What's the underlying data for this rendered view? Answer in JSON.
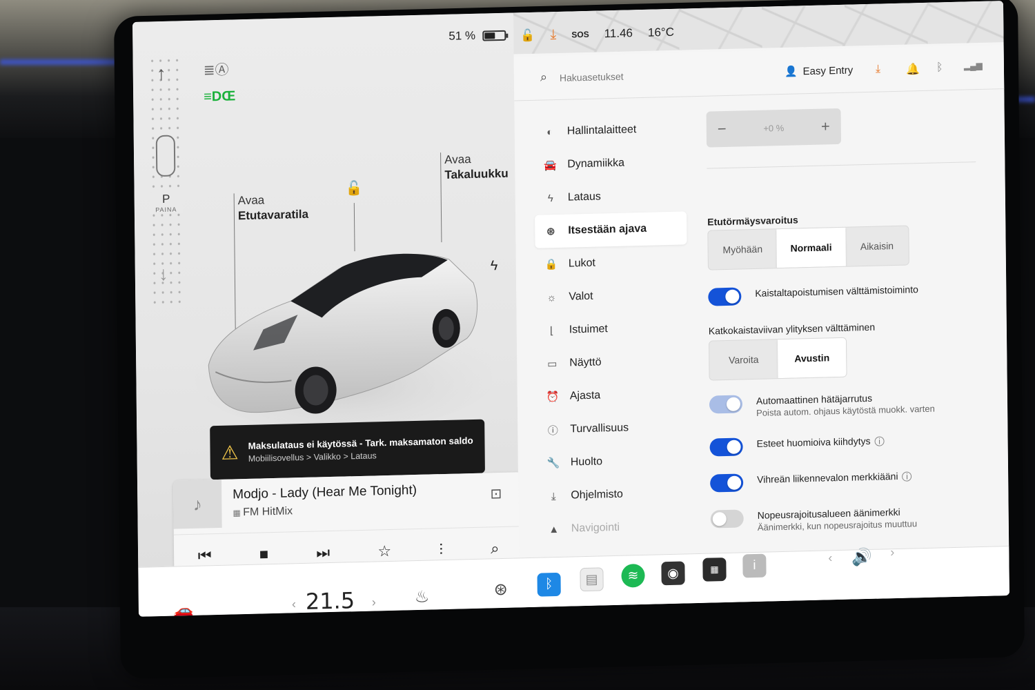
{
  "status": {
    "battery_pct": "51 %",
    "battery_level": 0.51,
    "sos": "SOS",
    "time": "11.46",
    "outside_temp": "16°C"
  },
  "left": {
    "gear": "P",
    "gear_hint": "PAINA",
    "label_frunk_1": "Avaa",
    "label_frunk_2": "Etutavaratila",
    "label_trunk_1": "Avaa",
    "label_trunk_2": "Takaluukku",
    "alert_title": "Maksulataus ei käytössä - Tark. maksamaton saldo",
    "alert_sub": "Mobiilisovellus > Valikko > Lataus"
  },
  "media": {
    "track": "Modjo - Lady (Hear Me Tonight)",
    "station": "FM HitMix"
  },
  "topbar": {
    "search_placeholder": "Hakuasetukset",
    "profile": "Easy Entry"
  },
  "nav": {
    "items": [
      {
        "label": "Hallintalaitteet",
        "icon": "toggle-icon"
      },
      {
        "label": "Dynamiikka",
        "icon": "car-icon"
      },
      {
        "label": "Lataus",
        "icon": "bolt-icon"
      },
      {
        "label": "Itsestään ajava",
        "icon": "steering-wheel-icon"
      },
      {
        "label": "Lukot",
        "icon": "lock-icon"
      },
      {
        "label": "Valot",
        "icon": "sun-icon"
      },
      {
        "label": "Istuimet",
        "icon": "seat-icon"
      },
      {
        "label": "Näyttö",
        "icon": "display-icon"
      },
      {
        "label": "Ajasta",
        "icon": "alarm-icon"
      },
      {
        "label": "Turvallisuus",
        "icon": "info-icon"
      },
      {
        "label": "Huolto",
        "icon": "wrench-icon"
      },
      {
        "label": "Ohjelmisto",
        "icon": "download-icon"
      },
      {
        "label": "Navigointi",
        "icon": "navigation-icon"
      }
    ]
  },
  "settings": {
    "stepper_value": "+0 %",
    "fcw_title": "Etutörmäysvaroitus",
    "fcw_options": [
      "Myöhään",
      "Normaali",
      "Aikaisin"
    ],
    "ldw_label": "Kaistaltapoistumisen välttämistoiminto",
    "solid_line_title": "Katkokaistaviivan ylityksen välttäminen",
    "solid_line_options": [
      "Varoita",
      "Avustin"
    ],
    "aeb_label": "Automaattinen hätäjarrutus",
    "aeb_sub": "Poista autom. ohjaus käytöstä muokk. varten",
    "obstacle_label": "Esteet huomioiva kiihdytys",
    "green_light_label": "Vihreän liikennevalon merkkiääni",
    "speed_zone_label": "Nopeusrajoitusalueen äänimerkki",
    "speed_zone_sub": "Äänimerkki, kun nopeusrajoitus muuttuu"
  },
  "dock": {
    "cabin_temp": "21.5"
  }
}
